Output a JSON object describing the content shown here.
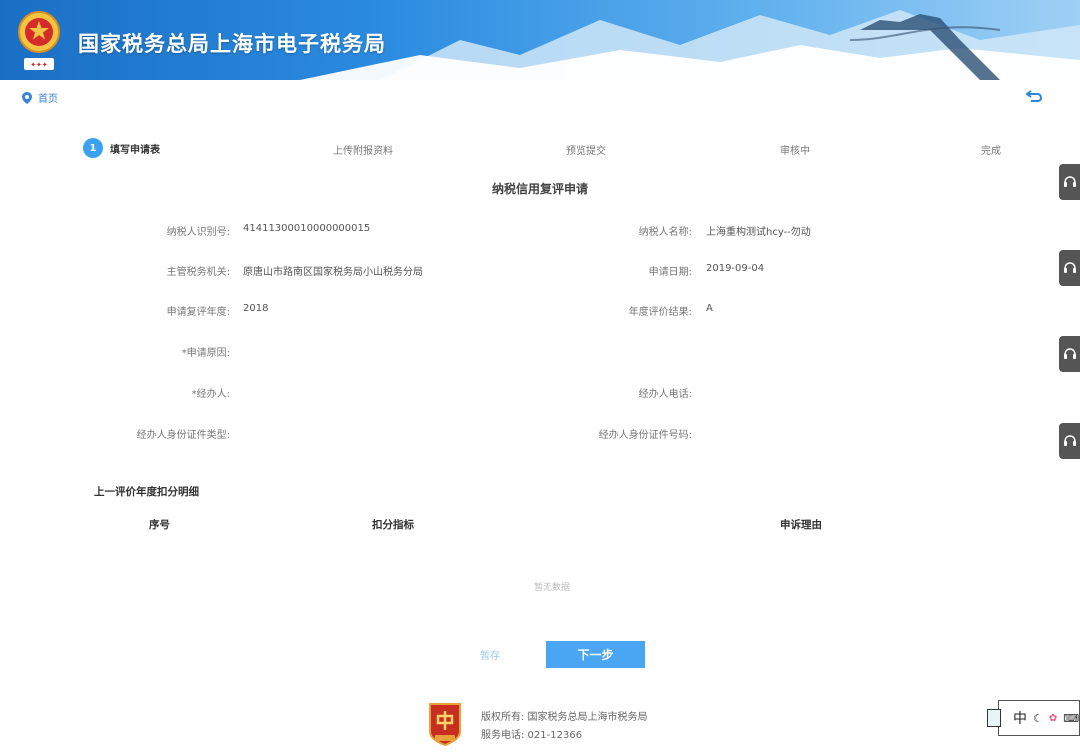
{
  "header": {
    "title": "国家税务总局上海市电子税务局",
    "emblem_icon": "tax-emblem-icon"
  },
  "breadcrumb": {
    "home": "首页"
  },
  "steps": [
    {
      "num": "1",
      "label": "填写申请表"
    },
    {
      "label": "上传附报资料"
    },
    {
      "label": "预览提交"
    },
    {
      "label": "审核中"
    },
    {
      "label": "完成"
    }
  ],
  "form": {
    "title": "纳税信用复评申请",
    "taxpayer_id_label": "纳税人识别号:",
    "taxpayer_id": "41411300010000000015",
    "taxpayer_name_label": "纳税人名称:",
    "taxpayer_name": "上海重构测试hcy--勿动",
    "authority_label": "主管税务机关:",
    "authority": "原唐山市路南区国家税务局小山税务分局",
    "apply_date_label": "申请日期:",
    "apply_date": "2019-09-04",
    "review_year_label": "申请复评年度:",
    "review_year": "2018",
    "result_label": "年度评价结果:",
    "result": "A",
    "reason_label": "*申请原因:",
    "handler_label": "*经办人:",
    "handler_phone_label": "经办人电话:",
    "id_type_label": "经办人身份证件类型:",
    "id_number_label": "经办人身份证件号码:"
  },
  "deduction": {
    "title": "上一评价年度扣分明细",
    "columns": [
      "序号",
      "扣分指标",
      "申诉理由"
    ],
    "empty": "暂无数据"
  },
  "actions": {
    "save": "暂存",
    "next": "下一步"
  },
  "footer": {
    "copyright": "版权所有: 国家税务总局上海市税务局",
    "phone": "服务电话: 021-12366"
  },
  "ime": {
    "mode": "中"
  },
  "colors": {
    "accent": "#4aa6f3",
    "header": "#2b8be0",
    "step_active": "#3ba0f0"
  }
}
